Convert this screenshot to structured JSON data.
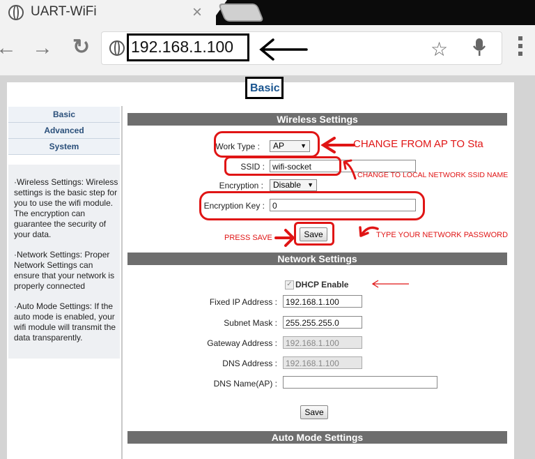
{
  "browser": {
    "tab_title": "UART-WiFi",
    "tab_close": "×",
    "url": "192.168.1.100",
    "back": "←",
    "forward": "→",
    "reload": "↻",
    "star": "☆"
  },
  "page": {
    "title": "Basic"
  },
  "sidebar": {
    "items": [
      {
        "label": "Basic"
      },
      {
        "label": "Advanced"
      },
      {
        "label": "System"
      }
    ],
    "help": [
      "·Wireless Settings: Wireless settings is the basic step for you to use the wifi module. The encryption can guarantee the security of your data.",
      "·Network Settings: Proper Network Settings can ensure that your network is properly connected",
      "·Auto Mode Settings: If the auto mode is enabled, your wifi module will transmit the data transparently."
    ]
  },
  "wireless": {
    "header": "Wireless Settings",
    "work_type_label": "Work Type :",
    "work_type_value": "AP",
    "ssid_label": "SSID :",
    "ssid_value": "wifi-socket",
    "encryption_label": "Encryption :",
    "encryption_value": "Disable",
    "key_label": "Encryption Key :",
    "key_value": "0",
    "save": "Save"
  },
  "network": {
    "header": "Network Settings",
    "dhcp_label": "DHCP Enable",
    "dhcp_checked": true,
    "fixed_ip_label": "Fixed IP Address :",
    "fixed_ip": "192.168.1.100",
    "subnet_label": "Subnet Mask :",
    "subnet": "255.255.255.0",
    "gateway_label": "Gateway Address :",
    "gateway": "192.168.1.100",
    "dns_label": "DNS Address :",
    "dns": "192.168.1.100",
    "dns_name_label": "DNS Name(AP) :",
    "dns_name": "",
    "save": "Save"
  },
  "auto_mode": {
    "header": "Auto Mode Settings"
  },
  "annotations": {
    "change_ap": "CHANGE FROM AP TO Sta",
    "change_ssid": "CHANGE TO LOCAL NETWORK SSID NAME",
    "press_save": "PRESS SAVE",
    "type_password": "TYPE YOUR NETWORK PASSWORD",
    "color": "#e01515"
  },
  "colors": {
    "section_bar": "#6e6e6e",
    "title_link": "#1a5590"
  }
}
